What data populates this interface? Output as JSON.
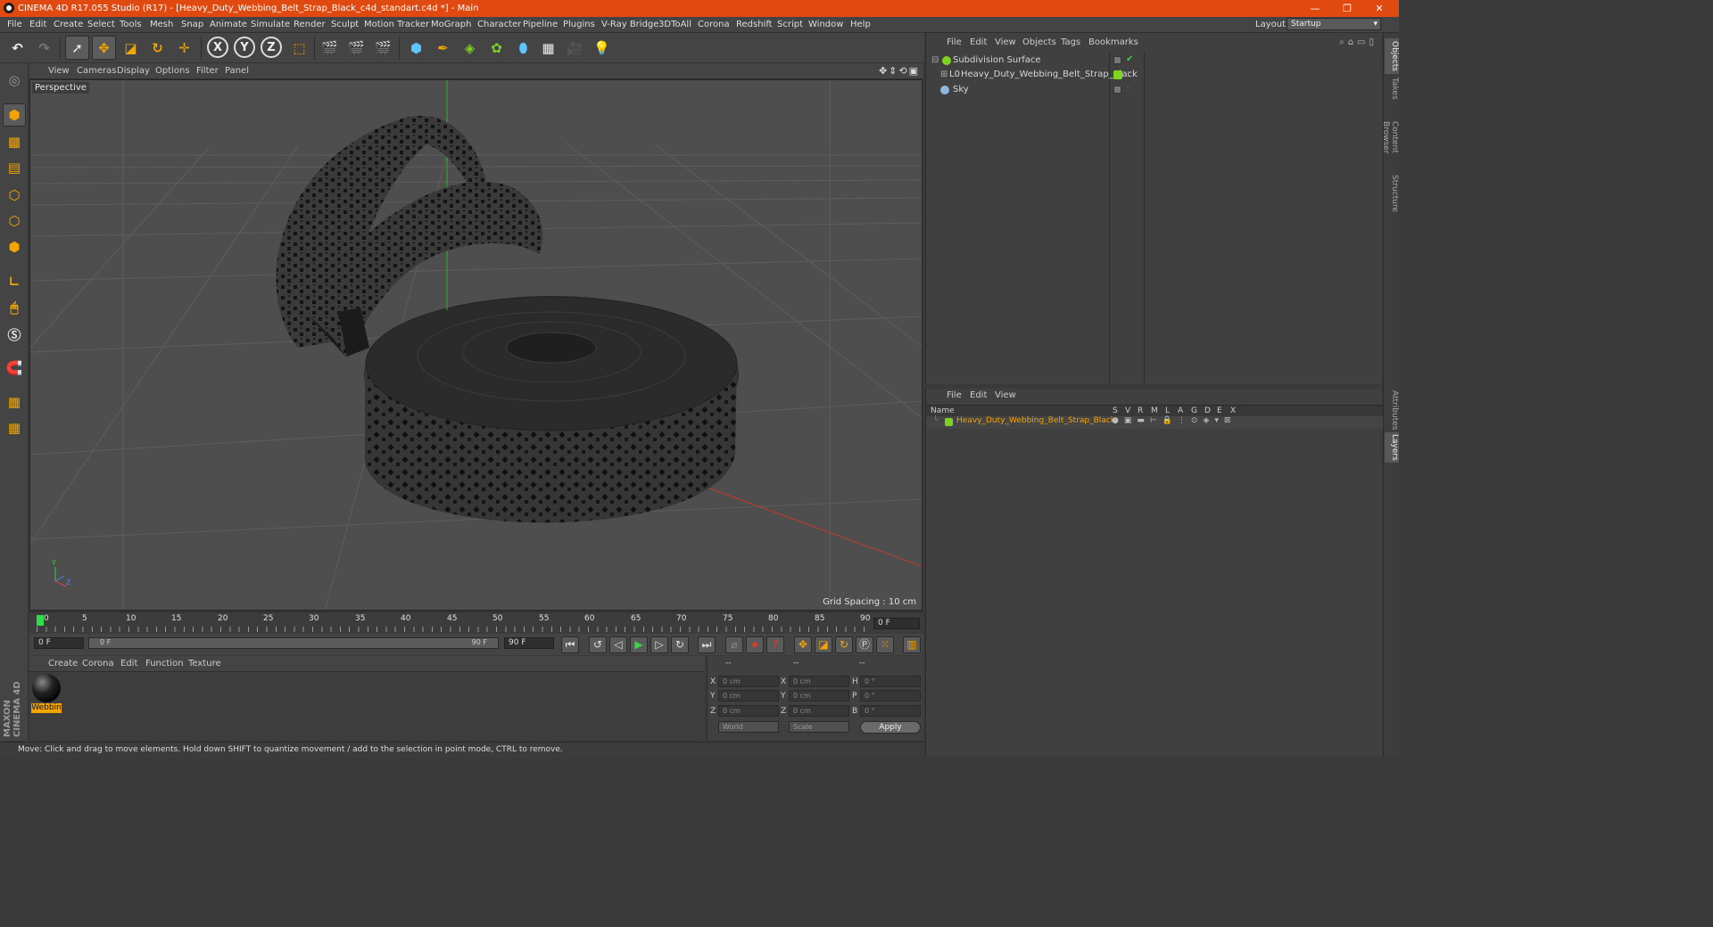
{
  "window": {
    "title": "CINEMA 4D R17.055 Studio (R17) - [Heavy_Duty_Webbing_Belt_Strap_Black_c4d_standart.c4d *] - Main",
    "minimize": "—",
    "restore": "❐",
    "close": "✕"
  },
  "menu": {
    "items": [
      "File",
      "Edit",
      "Create",
      "Select",
      "Tools",
      "Mesh",
      "Snap",
      "Animate",
      "Simulate",
      "Render",
      "Sculpt",
      "Motion Tracker",
      "MoGraph",
      "Character",
      "Pipeline",
      "Plugins",
      "V-Ray Bridge",
      "3DToAll",
      "Corona",
      "Redshift",
      "Script",
      "Window",
      "Help"
    ],
    "layout_label": "Layout:",
    "layout_value": "Startup"
  },
  "toolbar": {
    "undo": "↶",
    "redo": "↷",
    "axis_x": "X",
    "axis_y": "Y",
    "axis_z": "Z"
  },
  "viewport": {
    "menu": [
      "View",
      "Cameras",
      "Display",
      "Options",
      "Filter",
      "Panel"
    ],
    "camera_label": "Perspective",
    "grid_spacing": "Grid Spacing : 10 cm"
  },
  "timeline": {
    "ticks": [
      "0",
      "5",
      "10",
      "15",
      "20",
      "25",
      "30",
      "35",
      "40",
      "45",
      "50",
      "55",
      "60",
      "65",
      "70",
      "75",
      "80",
      "85",
      "90"
    ],
    "end_frame_field": "0 F",
    "current_start": "0 F",
    "slider_start": "0 F",
    "slider_end": "90 F",
    "max_frame": "90 F"
  },
  "material_manager": {
    "menu": [
      "Create",
      "Corona",
      "Edit",
      "Function",
      "Texture"
    ],
    "material_name": "Webbin"
  },
  "coordinates": {
    "headers": [
      "--",
      "--",
      "--"
    ],
    "rows": [
      {
        "l1": "X",
        "v1": "0 cm",
        "l2": "X",
        "v2": "0 cm",
        "l3": "H",
        "v3": "0 °"
      },
      {
        "l1": "Y",
        "v1": "0 cm",
        "l2": "Y",
        "v2": "0 cm",
        "l3": "P",
        "v3": "0 °"
      },
      {
        "l1": "Z",
        "v1": "0 cm",
        "l2": "Z",
        "v2": "0 cm",
        "l3": "B",
        "v3": "0 °"
      }
    ],
    "space": "World",
    "mode": "Scale",
    "apply": "Apply"
  },
  "status": {
    "text": "Move: Click and drag to move elements. Hold down SHIFT to quantize movement / add to the selection in point mode, CTRL to remove."
  },
  "objects_panel": {
    "menu": [
      "File",
      "Edit",
      "View",
      "Objects",
      "Tags",
      "Bookmarks"
    ],
    "objects": [
      {
        "name": "Subdivision Surface",
        "color": "#7ed321"
      },
      {
        "name": "Heavy_Duty_Webbing_Belt_Strap_Black",
        "color": "#dddddd"
      },
      {
        "name": "Sky",
        "color": "#8fb7e0"
      }
    ]
  },
  "layers_panel": {
    "menu": [
      "File",
      "Edit",
      "View"
    ],
    "col_name": "Name",
    "cols": [
      "S",
      "V",
      "R",
      "M",
      "L",
      "A",
      "G",
      "D",
      "E",
      "X"
    ],
    "layer_name": "Heavy_Duty_Webbing_Belt_Strap_Black",
    "layer_color": "#7ed321"
  },
  "right_tabs": [
    "Objects",
    "Takes",
    "Content Browser",
    "Structure",
    "Attributes",
    "Layers"
  ],
  "branding": "MAXON CINEMA 4D"
}
